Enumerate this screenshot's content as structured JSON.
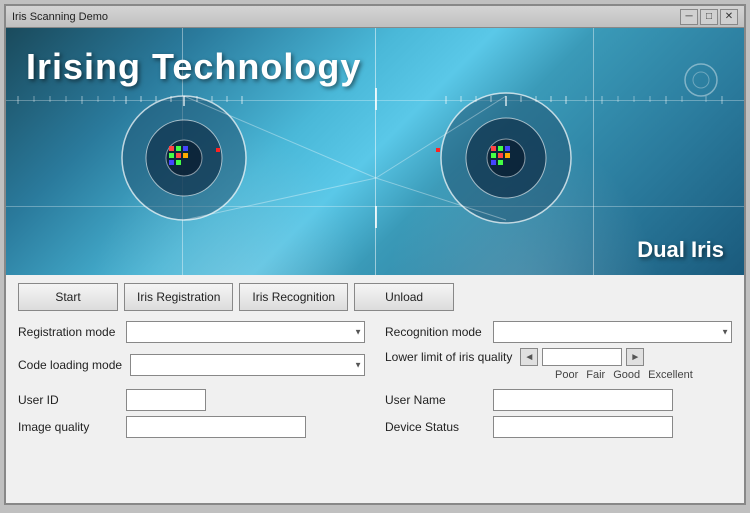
{
  "window": {
    "title": "Iris Scanning Demo",
    "title_btn_minimize": "─",
    "title_btn_restore": "□",
    "title_btn_close": "✕"
  },
  "banner": {
    "title": "Irising Technology",
    "dual_iris_label": "Dual Iris"
  },
  "buttons": {
    "start": "Start",
    "iris_registration": "Iris Registration",
    "iris_recognition": "Iris Recognition",
    "unload": "Unload"
  },
  "form": {
    "registration_mode_label": "Registration mode",
    "recognition_mode_label": "Recognition mode",
    "code_loading_mode_label": "Code loading mode",
    "iris_quality_label": "Lower limit of iris quality",
    "user_id_label": "User ID",
    "user_name_label": "User Name",
    "image_quality_label": "Image quality",
    "device_status_label": "Device Status",
    "quality_levels": [
      "Poor",
      "Fair",
      "Good",
      "Excellent"
    ]
  },
  "icons": {
    "left_arrow": "◄",
    "right_arrow": "►",
    "dropdown_arrow": "▼"
  }
}
